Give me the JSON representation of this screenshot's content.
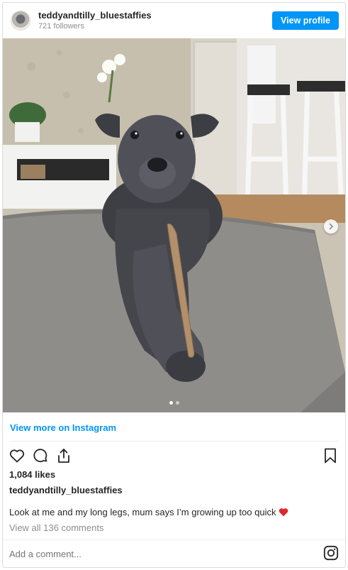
{
  "header": {
    "username": "teddyandtilly_bluestaffies",
    "followers": "721 followers",
    "view_profile_label": "View profile",
    "avatar_icon": "profile-avatar"
  },
  "photo": {
    "carousel_total": 2,
    "carousel_index": 1,
    "next_icon": "chevron-right-icon"
  },
  "view_more_label": "View more on Instagram",
  "actions": {
    "icons": [
      "heart-icon",
      "comment-icon",
      "share-icon"
    ],
    "save_icon": "bookmark-icon"
  },
  "likes": "1,084 likes",
  "caption": {
    "username": "teddyandtilly_bluestaffies",
    "text": "Look at me and my long legs, mum says I’m growing up too quick",
    "emoji": "red-heart"
  },
  "comments_link": "View all 136 comments",
  "comment_input": {
    "placeholder": "Add a comment..."
  },
  "colors": {
    "accent": "#0095f6",
    "muted": "#8e8e8e",
    "text": "#262626"
  }
}
